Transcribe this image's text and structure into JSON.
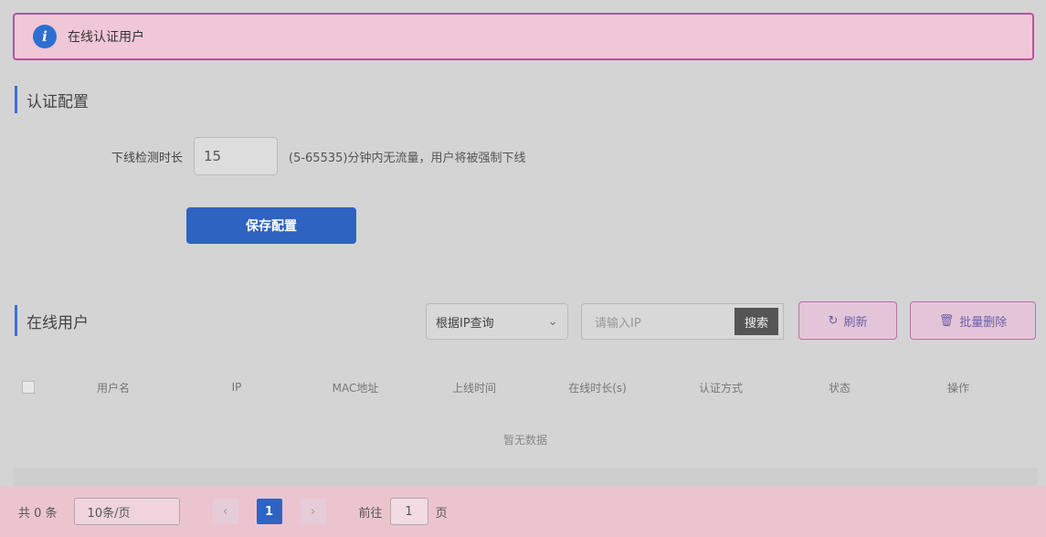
{
  "alert": {
    "text": "在线认证用户"
  },
  "config": {
    "section_title": "认证配置",
    "label": "下线检测时长",
    "value": "15",
    "hint": "(5-65535)分钟内无流量，用户将被强制下线",
    "save_label": "保存配置"
  },
  "online": {
    "section_title": "在线用户",
    "search_select": "根据IP查询",
    "search_placeholder": "请输入IP",
    "search_button": "搜索",
    "refresh_label": "刷新",
    "delete_label": "批量删除"
  },
  "table": {
    "columns": [
      "用户名",
      "IP",
      "MAC地址",
      "上线时间",
      "在线时长(s)",
      "认证方式",
      "状态",
      "操作"
    ],
    "empty_text": "暂无数据"
  },
  "pager": {
    "total": "共 0 条",
    "page_size": "10条/页",
    "current_page": "1",
    "goto_label": "前往",
    "goto_value": "1",
    "goto_suffix": "页"
  }
}
